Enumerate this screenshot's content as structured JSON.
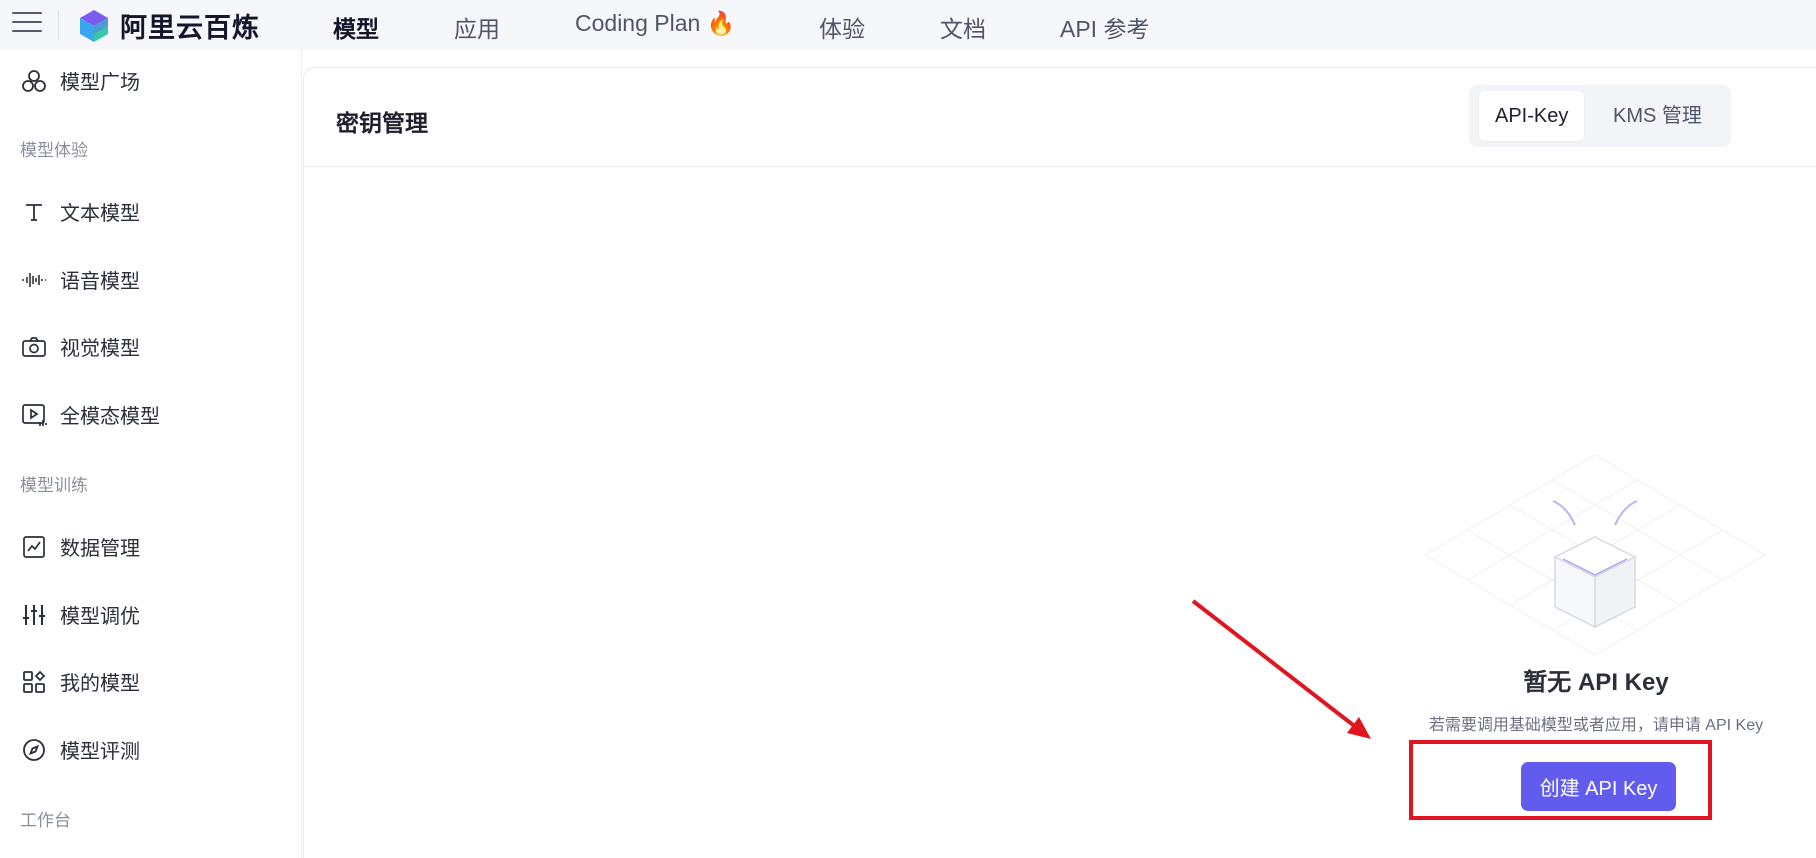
{
  "header": {
    "logo_text": "阿里云百炼",
    "nav": [
      {
        "label": "模型",
        "active": true
      },
      {
        "label": "应用"
      },
      {
        "label": "Coding Plan",
        "emoji": "🔥"
      },
      {
        "label": "体验"
      },
      {
        "label": "文档"
      },
      {
        "label": "API 参考"
      }
    ]
  },
  "sidebar": {
    "top_item": {
      "label": "模型广场",
      "icon": "model-plaza-icon"
    },
    "groups": [
      {
        "title": "模型体验",
        "items": [
          {
            "label": "文本模型",
            "icon": "text-icon"
          },
          {
            "label": "语音模型",
            "icon": "audio-wave-icon"
          },
          {
            "label": "视觉模型",
            "icon": "camera-icon"
          },
          {
            "label": "全模态模型",
            "icon": "omni-video-icon"
          }
        ]
      },
      {
        "title": "模型训练",
        "items": [
          {
            "label": "数据管理",
            "icon": "chart-icon"
          },
          {
            "label": "模型调优",
            "icon": "sliders-icon"
          },
          {
            "label": "我的模型",
            "icon": "apps-icon"
          },
          {
            "label": "模型评测",
            "icon": "compass-icon"
          }
        ]
      },
      {
        "title": "工作台",
        "items": []
      }
    ]
  },
  "main": {
    "title": "密钥管理",
    "tabs": [
      {
        "label": "API-Key",
        "active": true
      },
      {
        "label": "KMS 管理"
      }
    ],
    "empty_state": {
      "title": "暂无 API Key",
      "description": "若需要调用基础模型或者应用，请申请 API Key",
      "button_label": "创建 API Key"
    }
  },
  "colors": {
    "accent": "#615ced",
    "annotation": "#e0151f",
    "topbar_bg": "#f6f7fb"
  }
}
